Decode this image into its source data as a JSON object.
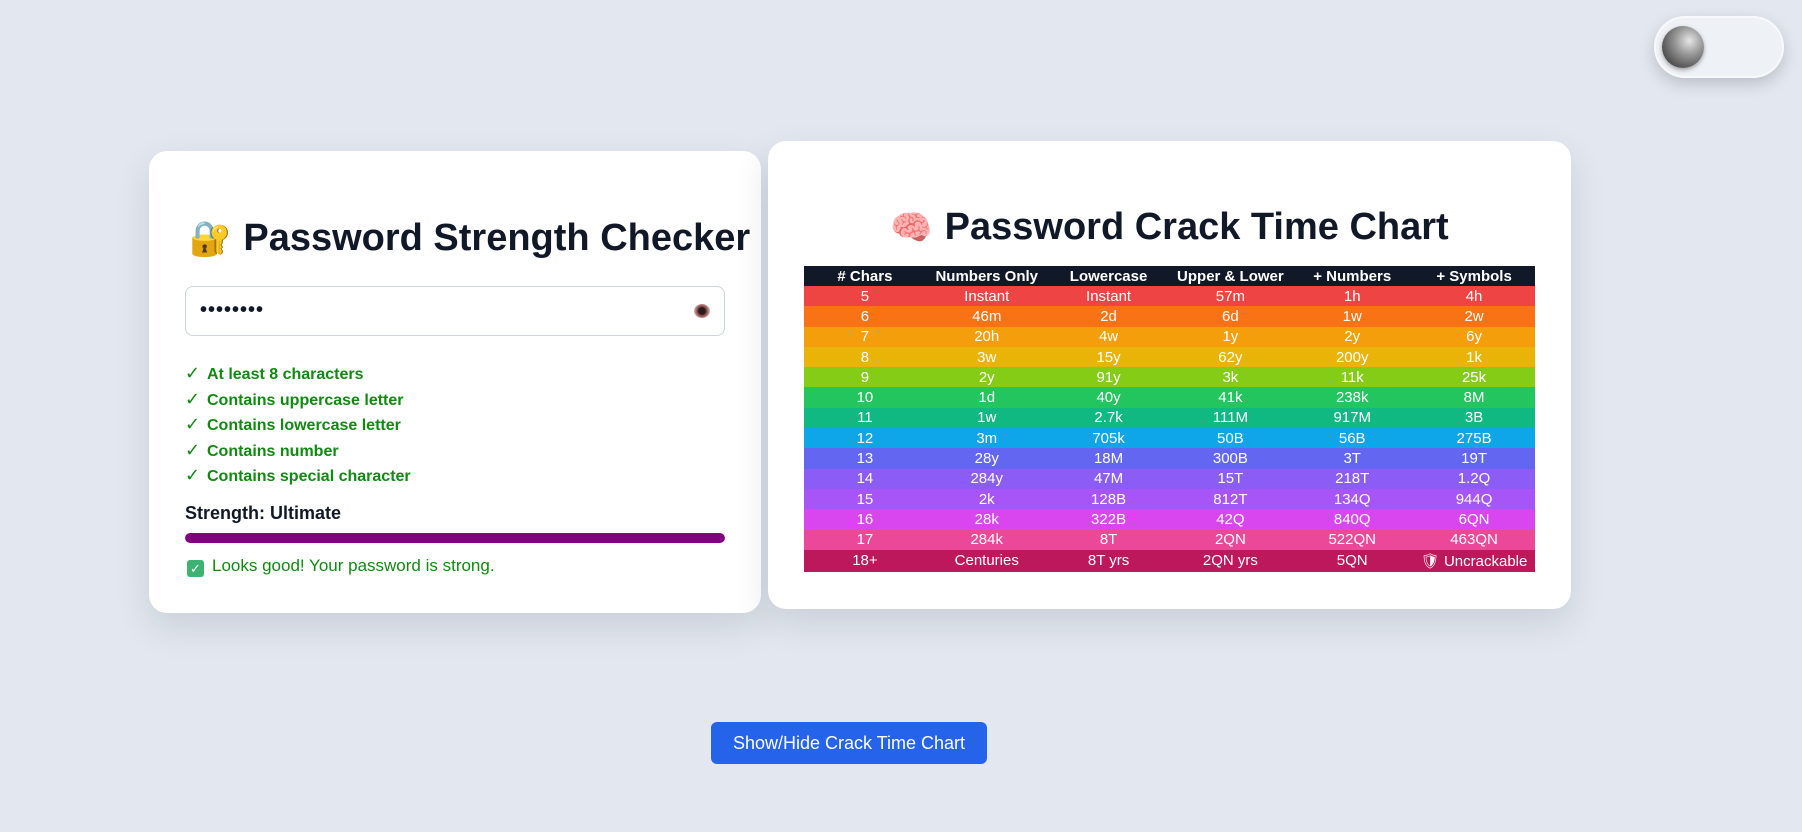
{
  "theme_toggle": {
    "state": "off"
  },
  "checker": {
    "title_emoji": "🔐",
    "title": "Password Strength Checker",
    "password_value": "••••••••",
    "show_password_icon": "eye-icon",
    "criteria": [
      {
        "check": "✓",
        "label": "At least 8 characters"
      },
      {
        "check": "✓",
        "label": "Contains uppercase letter"
      },
      {
        "check": "✓",
        "label": "Contains lowercase letter"
      },
      {
        "check": "✓",
        "label": "Contains number"
      },
      {
        "check": "✓",
        "label": "Contains special character"
      }
    ],
    "strength_label": "Strength: Ultimate",
    "strength_level": 1.0,
    "strength_color": "#800080",
    "feedback_icon": "✓",
    "feedback": "Looks good! Your password is strong."
  },
  "crack_chart": {
    "title_emoji": "🧠",
    "title": "Password Crack Time Chart",
    "columns": [
      "# Chars",
      "Numbers Only",
      "Lowercase",
      "Upper & Lower",
      "+ Numbers",
      "+ Symbols"
    ],
    "rows": [
      {
        "color": "#ef4444",
        "cells": [
          "5",
          "Instant",
          "Instant",
          "57m",
          "1h",
          "4h"
        ]
      },
      {
        "color": "#f97316",
        "cells": [
          "6",
          "46m",
          "2d",
          "6d",
          "1w",
          "2w"
        ]
      },
      {
        "color": "#f59e0b",
        "cells": [
          "7",
          "20h",
          "4w",
          "1y",
          "2y",
          "6y"
        ]
      },
      {
        "color": "#eab308",
        "cells": [
          "8",
          "3w",
          "15y",
          "62y",
          "200y",
          "1k"
        ]
      },
      {
        "color": "#84cc16",
        "cells": [
          "9",
          "2y",
          "91y",
          "3k",
          "11k",
          "25k"
        ]
      },
      {
        "color": "#22c55e",
        "cells": [
          "10",
          "1d",
          "40y",
          "41k",
          "238k",
          "8M"
        ]
      },
      {
        "color": "#10b981",
        "cells": [
          "11",
          "1w",
          "2.7k",
          "111M",
          "917M",
          "3B"
        ]
      },
      {
        "color": "#0ea5e9",
        "cells": [
          "12",
          "3m",
          "705k",
          "50B",
          "56B",
          "275B"
        ]
      },
      {
        "color": "#6366f1",
        "cells": [
          "13",
          "28y",
          "18M",
          "300B",
          "3T",
          "19T"
        ]
      },
      {
        "color": "#8b5cf6",
        "cells": [
          "14",
          "284y",
          "47M",
          "15T",
          "218T",
          "1.2Q"
        ]
      },
      {
        "color": "#a855f7",
        "cells": [
          "15",
          "2k",
          "128B",
          "812T",
          "134Q",
          "944Q"
        ]
      },
      {
        "color": "#d946ef",
        "cells": [
          "16",
          "28k",
          "322B",
          "42Q",
          "840Q",
          "6QN"
        ]
      },
      {
        "color": "#ec4899",
        "cells": [
          "17",
          "284k",
          "8T",
          "2QN",
          "522QN",
          "463QN"
        ]
      },
      {
        "color": "#be185d",
        "cells": [
          "18+",
          "Centuries",
          "8T yrs",
          "2QN yrs",
          "5QN",
          "🛡 Uncrackable"
        ]
      }
    ]
  },
  "toggle_chart_button": "Show/Hide Crack Time Chart"
}
